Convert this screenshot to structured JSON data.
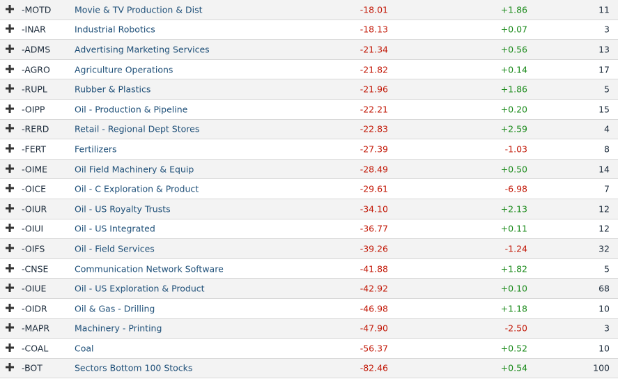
{
  "colors": {
    "negative": "#c21807",
    "positive": "#1a8a1a",
    "link": "#1e4f78"
  },
  "rows": [
    {
      "ticker": "-MOTD",
      "name": "Movie & TV Production & Dist",
      "perf": "-18.01",
      "change": "+1.86",
      "count": "11"
    },
    {
      "ticker": "-INAR",
      "name": "Industrial Robotics",
      "perf": "-18.13",
      "change": "+0.07",
      "count": "3"
    },
    {
      "ticker": "-ADMS",
      "name": "Advertising Marketing Services",
      "perf": "-21.34",
      "change": "+0.56",
      "count": "13"
    },
    {
      "ticker": "-AGRO",
      "name": "Agriculture Operations",
      "perf": "-21.82",
      "change": "+0.14",
      "count": "17"
    },
    {
      "ticker": "-RUPL",
      "name": "Rubber & Plastics",
      "perf": "-21.96",
      "change": "+1.86",
      "count": "5"
    },
    {
      "ticker": "-OIPP",
      "name": "Oil - Production & Pipeline",
      "perf": "-22.21",
      "change": "+0.20",
      "count": "15"
    },
    {
      "ticker": "-RERD",
      "name": "Retail - Regional Dept Stores",
      "perf": "-22.83",
      "change": "+2.59",
      "count": "4"
    },
    {
      "ticker": "-FERT",
      "name": "Fertilizers",
      "perf": "-27.39",
      "change": "-1.03",
      "count": "8"
    },
    {
      "ticker": "-OIME",
      "name": "Oil Field Machinery & Equip",
      "perf": "-28.49",
      "change": "+0.50",
      "count": "14"
    },
    {
      "ticker": "-OICE",
      "name": "Oil - C Exploration & Product",
      "perf": "-29.61",
      "change": "-6.98",
      "count": "7"
    },
    {
      "ticker": "-OIUR",
      "name": "Oil - US Royalty Trusts",
      "perf": "-34.10",
      "change": "+2.13",
      "count": "12"
    },
    {
      "ticker": "-OIUI",
      "name": "Oil - US Integrated",
      "perf": "-36.77",
      "change": "+0.11",
      "count": "12"
    },
    {
      "ticker": "-OIFS",
      "name": "Oil - Field Services",
      "perf": "-39.26",
      "change": "-1.24",
      "count": "32"
    },
    {
      "ticker": "-CNSE",
      "name": "Communication Network Software",
      "perf": "-41.88",
      "change": "+1.82",
      "count": "5"
    },
    {
      "ticker": "-OIUE",
      "name": "Oil - US Exploration & Product",
      "perf": "-42.92",
      "change": "+0.10",
      "count": "68"
    },
    {
      "ticker": "-OIDR",
      "name": "Oil & Gas - Drilling",
      "perf": "-46.98",
      "change": "+1.18",
      "count": "10"
    },
    {
      "ticker": "-MAPR",
      "name": "Machinery - Printing",
      "perf": "-47.90",
      "change": "-2.50",
      "count": "3"
    },
    {
      "ticker": "-COAL",
      "name": "Coal",
      "perf": "-56.37",
      "change": "+0.52",
      "count": "10"
    },
    {
      "ticker": "-BOT",
      "name": "Sectors Bottom 100 Stocks",
      "perf": "-82.46",
      "change": "+0.54",
      "count": "100"
    }
  ]
}
